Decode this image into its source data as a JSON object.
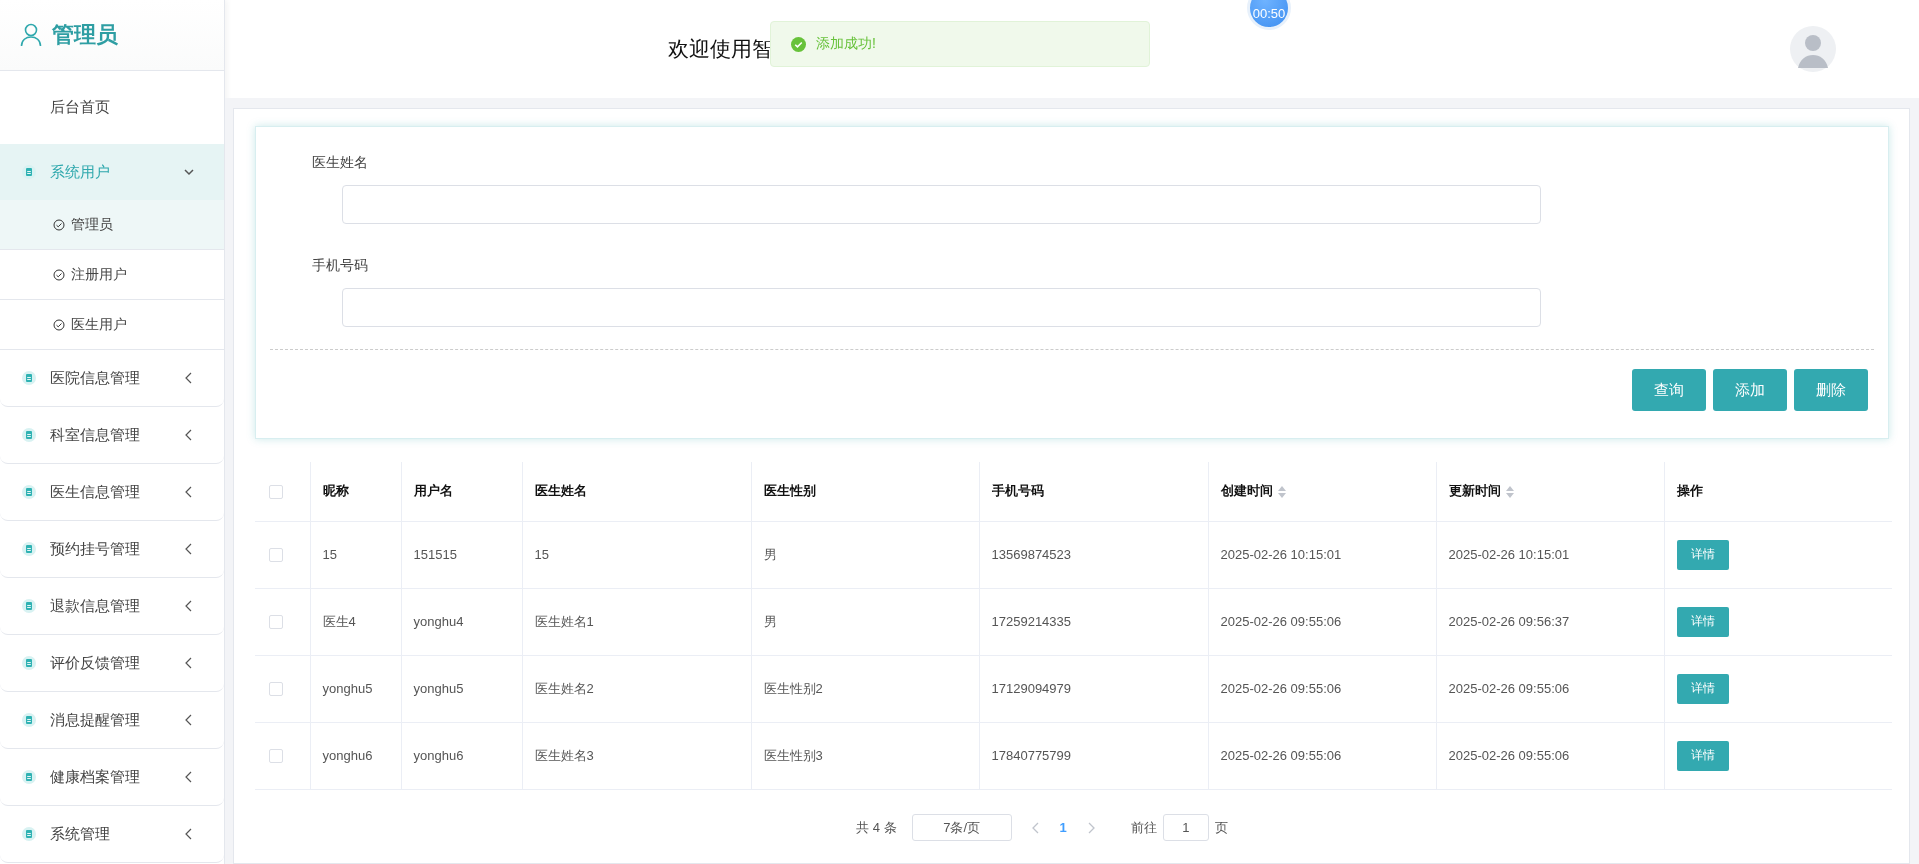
{
  "sidebar": {
    "title": "管理员",
    "items": [
      {
        "label": "后台首页",
        "kind": "link"
      },
      {
        "label": "系统用户",
        "kind": "group",
        "expanded": true,
        "children": [
          {
            "label": "管理员",
            "selected": true
          },
          {
            "label": "注册用户",
            "selected": false
          },
          {
            "label": "医生用户",
            "selected": false
          }
        ]
      },
      {
        "label": "医院信息管理",
        "kind": "group",
        "expanded": false
      },
      {
        "label": "科室信息管理",
        "kind": "group",
        "expanded": false
      },
      {
        "label": "医生信息管理",
        "kind": "group",
        "expanded": false
      },
      {
        "label": "预约挂号管理",
        "kind": "group",
        "expanded": false
      },
      {
        "label": "退款信息管理",
        "kind": "group",
        "expanded": false
      },
      {
        "label": "评价反馈管理",
        "kind": "group",
        "expanded": false
      },
      {
        "label": "消息提醒管理",
        "kind": "group",
        "expanded": false
      },
      {
        "label": "健康档案管理",
        "kind": "group",
        "expanded": false
      },
      {
        "label": "系统管理",
        "kind": "group",
        "expanded": false
      }
    ]
  },
  "header": {
    "welcome": "欢迎使用智",
    "timer": "00:50",
    "toast": {
      "message": "添加成功!"
    }
  },
  "search": {
    "fields": [
      {
        "label": "医生姓名"
      },
      {
        "label": "手机号码"
      }
    ],
    "buttons": [
      "查询",
      "添加",
      "删除"
    ]
  },
  "table": {
    "all_checked": false,
    "columns": [
      {
        "label": "昵称",
        "sortable": false
      },
      {
        "label": "用户名",
        "sortable": false
      },
      {
        "label": "医生姓名",
        "sortable": false
      },
      {
        "label": "医生性别",
        "sortable": false
      },
      {
        "label": "手机号码",
        "sortable": false
      },
      {
        "label": "创建时间",
        "sortable": true
      },
      {
        "label": "更新时间",
        "sortable": true
      },
      {
        "label": "操作",
        "sortable": false
      }
    ],
    "rows": [
      {
        "checked": false,
        "cells": [
          "15",
          "151515",
          "15",
          "男",
          "13569874523",
          "2025-02-26 10:15:01",
          "2025-02-26 10:15:01"
        ],
        "action": "详情"
      },
      {
        "checked": false,
        "cells": [
          "医生4",
          "yonghu4",
          "医生姓名1",
          "男",
          "17259214335",
          "2025-02-26 09:55:06",
          "2025-02-26 09:56:37"
        ],
        "action": "详情"
      },
      {
        "checked": false,
        "cells": [
          "yonghu5",
          "yonghu5",
          "医生姓名2",
          "医生性别2",
          "17129094979",
          "2025-02-26 09:55:06",
          "2025-02-26 09:55:06"
        ],
        "action": "详情"
      },
      {
        "checked": false,
        "cells": [
          "yonghu6",
          "yonghu6",
          "医生姓名3",
          "医生性别3",
          "17840775799",
          "2025-02-26 09:55:06",
          "2025-02-26 09:55:06"
        ],
        "action": "详情"
      }
    ]
  },
  "pagination": {
    "total": "共 4 条",
    "page_size": "7条/页",
    "pages": [
      {
        "label": "1",
        "selected": true
      }
    ],
    "goto_label": "前往",
    "goto_value": "1",
    "goto_suffix": "页"
  }
}
